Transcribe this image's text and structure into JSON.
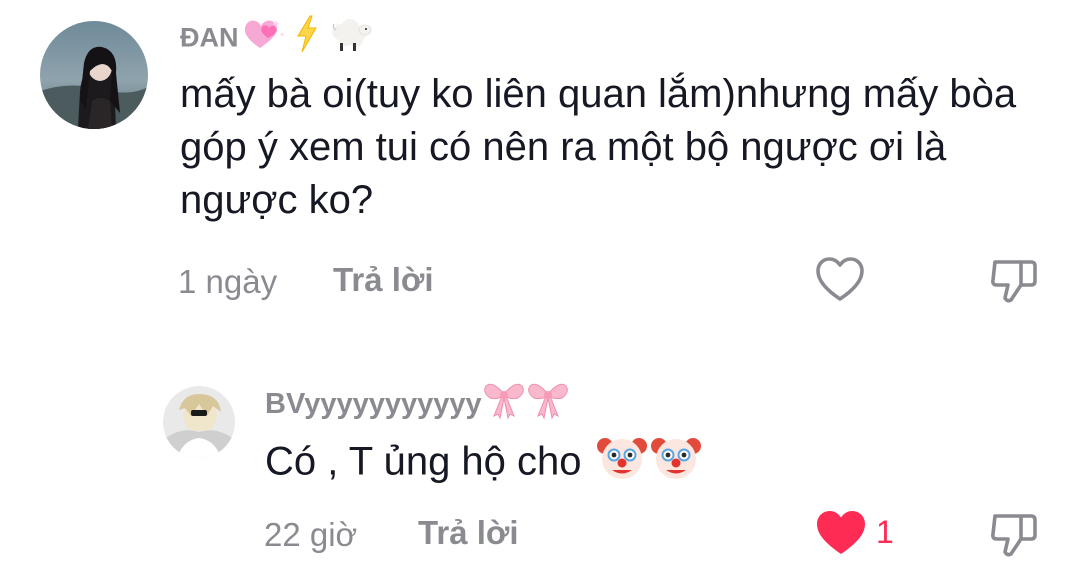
{
  "comments": [
    {
      "username": "ĐAN",
      "username_emojis": [
        "sparkling-heart-emoji",
        "lightning-emoji",
        "sheep-emoji"
      ],
      "text": "mấy bà oi(tuy ko liên quan lắm)nhưng mấy bòa góp ý xem tui có nên ra một bộ ngược ơi là ngược ko?",
      "time": "1 ngày",
      "reply_label": "Trả lời",
      "liked": false,
      "like_count": ""
    },
    {
      "username": "BVyyyyyyyyyyy",
      "username_emojis": [
        "ribbon-emoji",
        "ribbon-emoji"
      ],
      "text": "Có , T ủng hộ cho",
      "text_emojis": [
        "clown-face-emoji",
        "clown-face-emoji"
      ],
      "time": "22 giờ",
      "reply_label": "Trả lời",
      "liked": true,
      "like_count": "1"
    }
  ],
  "colors": {
    "liked": "#fe2c55",
    "muted": "#8a8b91",
    "text": "#161823"
  }
}
